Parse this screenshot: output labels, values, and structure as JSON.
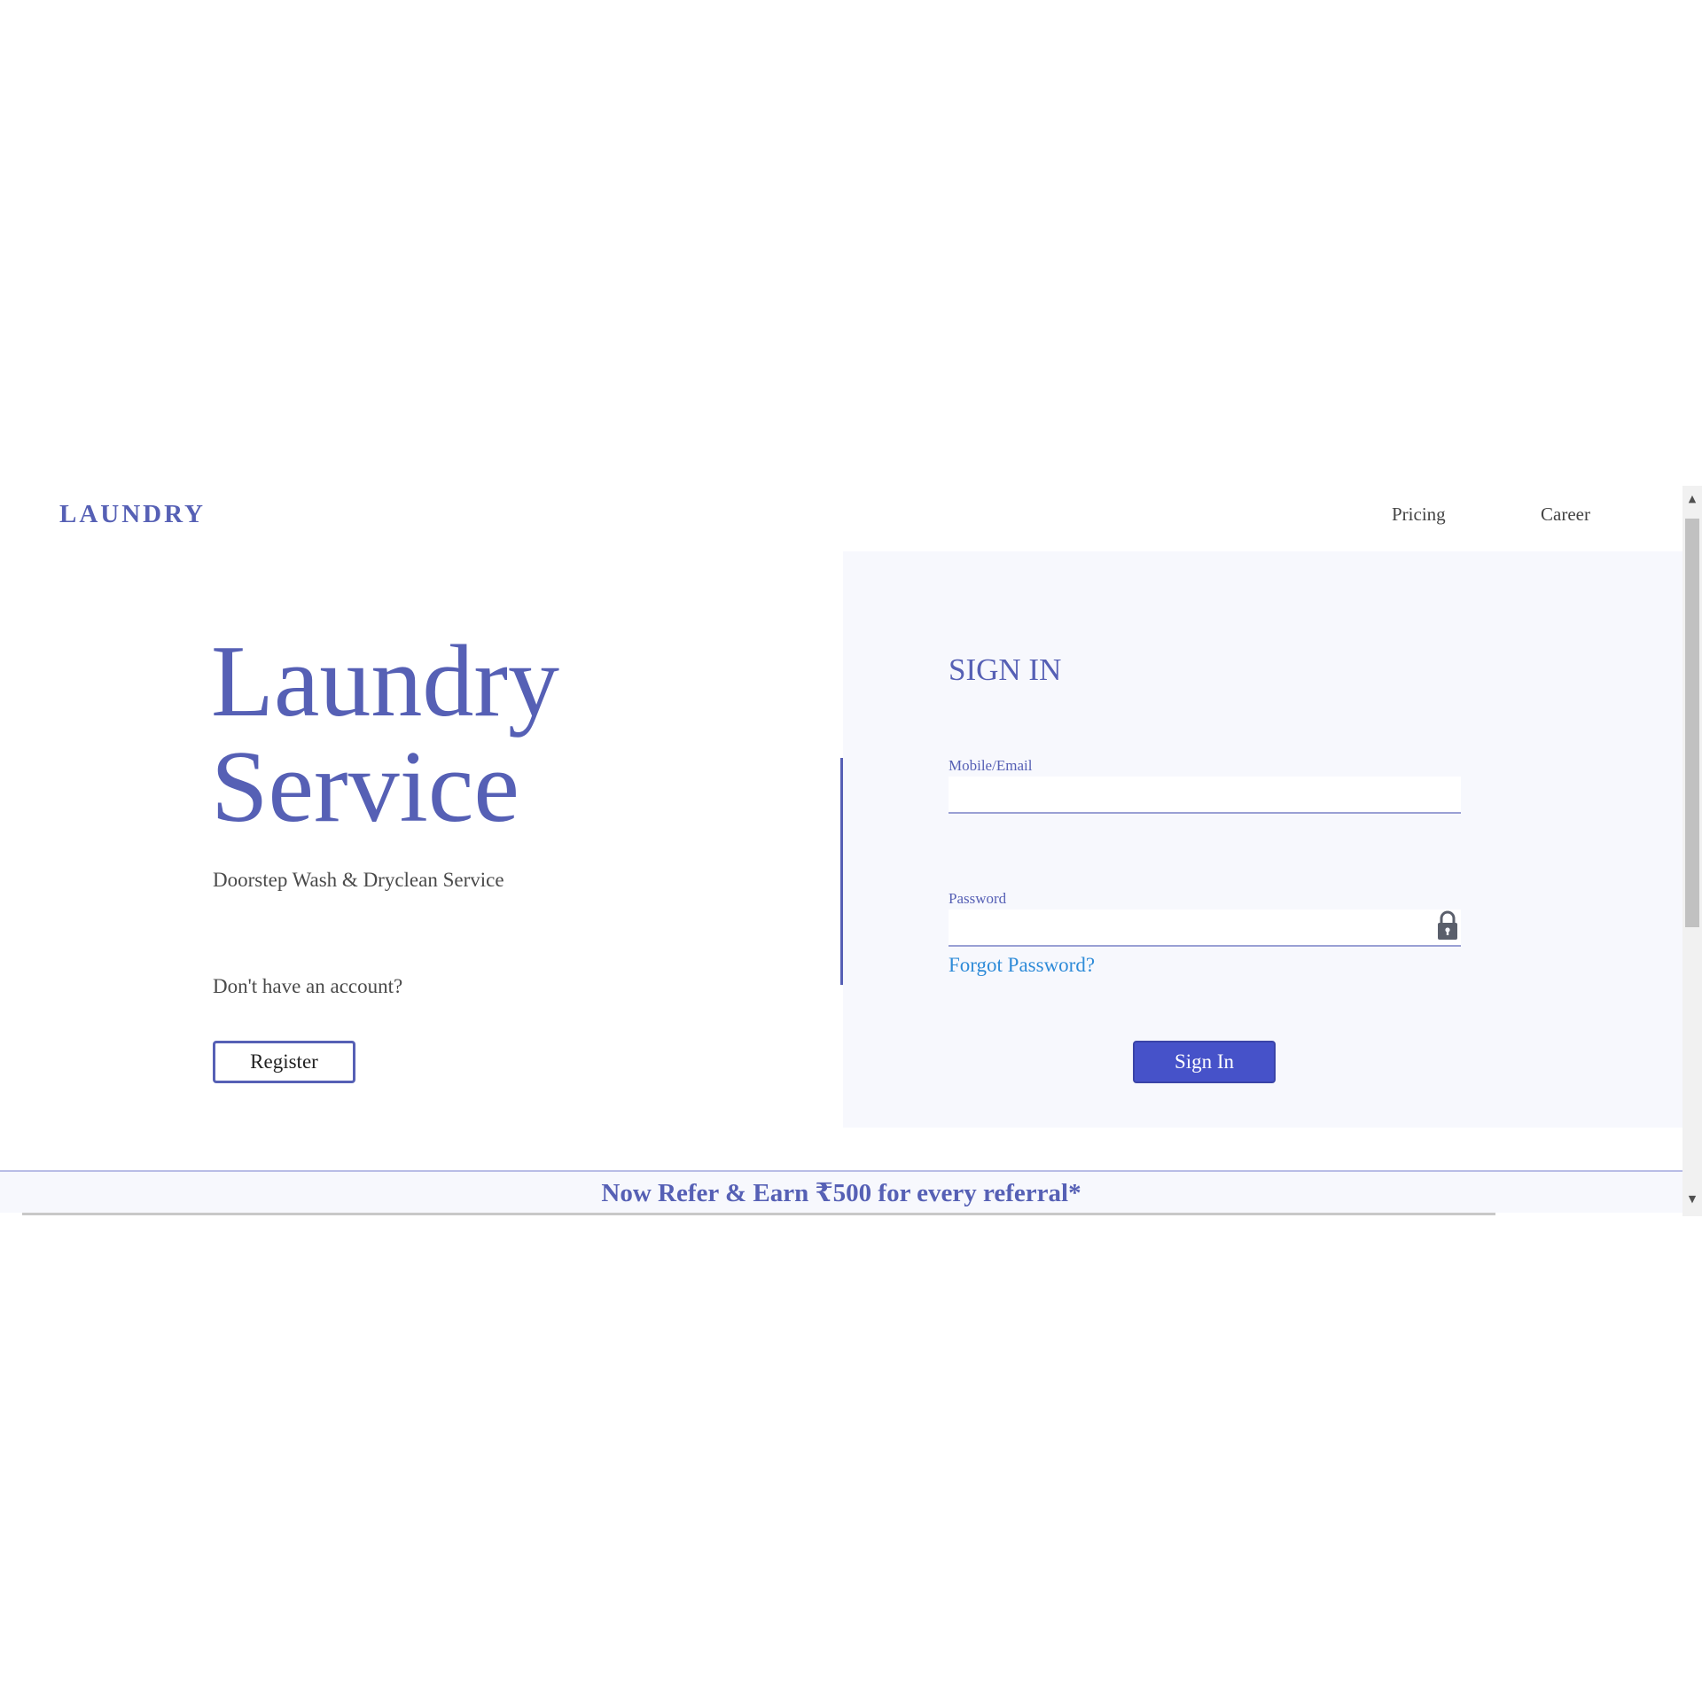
{
  "header": {
    "brand": "LAUNDRY",
    "nav": [
      {
        "label": "Pricing"
      },
      {
        "label": "Career"
      }
    ]
  },
  "hero": {
    "title_line1": "Laundry",
    "title_line2": "Service",
    "subtitle": "Doorstep Wash & Dryclean Service",
    "no_account": "Don't have an account?",
    "register_label": "Register"
  },
  "signin": {
    "title": "SIGN IN",
    "email_label": "Mobile/Email",
    "email_value": "",
    "password_label": "Password",
    "password_value": "",
    "password_icon": "lock-icon",
    "forgot_label": "Forgot Password?",
    "submit_label": "Sign In"
  },
  "banner": {
    "text": "Now Refer & Earn ₹500 for every referral*"
  },
  "colors": {
    "brand": "#5660b5",
    "primary_button": "#4652c9",
    "link": "#2e8bd8",
    "panel_bg": "#f7f8fd"
  }
}
